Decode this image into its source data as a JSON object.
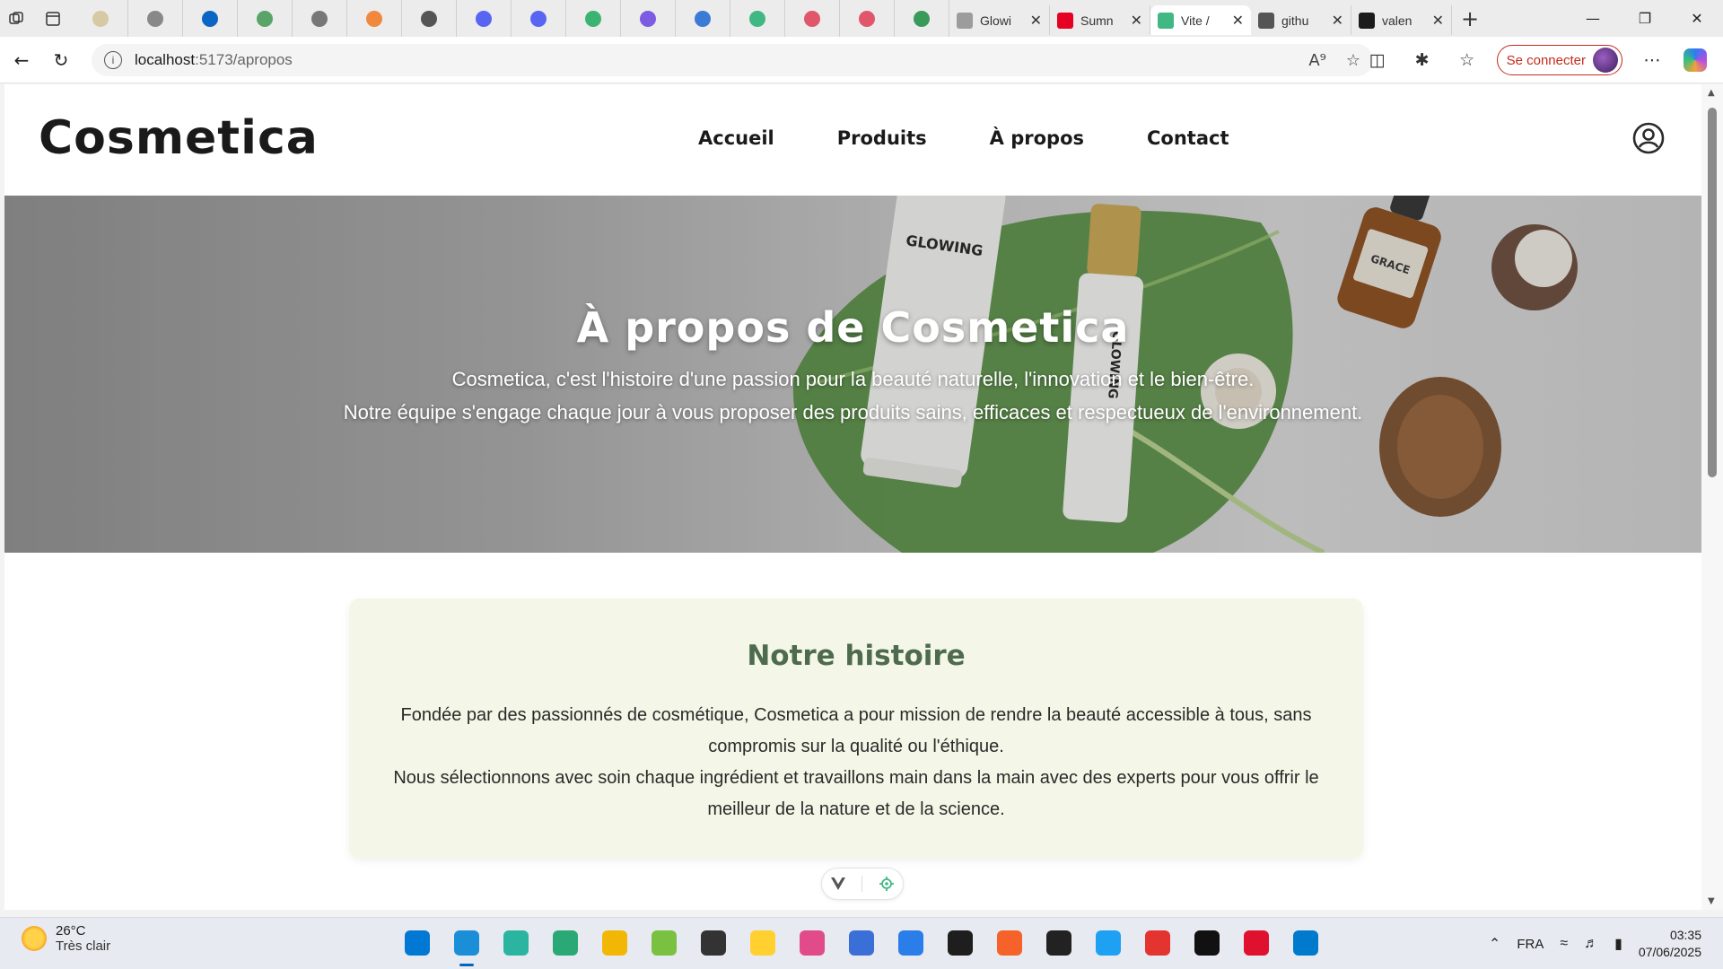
{
  "browser": {
    "pinned_tabs": [
      {
        "icon": "mug-icon",
        "color": "#d8c9a5"
      },
      {
        "icon": "circle-logo-icon",
        "color": "#888888"
      },
      {
        "icon": "linkedin-icon",
        "color": "#0a66c2"
      },
      {
        "icon": "w-logo-icon",
        "color": "#5aa469"
      },
      {
        "icon": "j-logo-icon",
        "color": "#777777"
      },
      {
        "icon": "diamond-icon",
        "color": "#f0883e"
      },
      {
        "icon": "openai-icon",
        "color": "#555555"
      },
      {
        "icon": "discord-icon",
        "color": "#5865f2"
      },
      {
        "icon": "globe-icon",
        "color": "#5865f2"
      },
      {
        "icon": "flower-icon",
        "color": "#3cb371"
      },
      {
        "icon": "canva-icon",
        "color": "#7b5ce3"
      },
      {
        "icon": "c-logo-icon",
        "color": "#3a7bd5"
      },
      {
        "icon": "vue-icon",
        "color": "#41b883"
      },
      {
        "icon": "youtube-icon",
        "color": "#e0566b"
      },
      {
        "icon": "youtube-icon",
        "color": "#e0566b"
      },
      {
        "icon": "leaf-icon",
        "color": "#3a9a5a"
      }
    ],
    "tabs": [
      {
        "title": "Glowi",
        "icon": "g-logo-icon",
        "color": "#9c9c9c",
        "active": false
      },
      {
        "title": "Sumn",
        "icon": "pinterest-icon",
        "color": "#e60023",
        "active": false
      },
      {
        "title": "Vite /",
        "icon": "vue-icon",
        "color": "#41b883",
        "active": true
      },
      {
        "title": "githu",
        "icon": "search-icon",
        "color": "#555555",
        "active": false
      },
      {
        "title": "valen",
        "icon": "github-icon",
        "color": "#1b1b1b",
        "active": false
      }
    ],
    "url_host": "localhost",
    "url_rest": ":5173/apropos",
    "connect_label": "Se connecter"
  },
  "site": {
    "logo": "Cosmetica",
    "nav": [
      "Accueil",
      "Produits",
      "À propos",
      "Contact"
    ],
    "hero": {
      "title": "À propos de Cosmetica",
      "line1": "Cosmetica, c'est l'histoire d'une passion pour la beauté naturelle, l'innovation et le bien-être.",
      "line2": "Notre équipe s'engage chaque jour à vous proposer des produits sains, efficaces et respectueux de l'environnement.",
      "product_labels": [
        "GLOWING",
        "GLOWING",
        "GRACE"
      ]
    },
    "story": {
      "title": "Notre histoire",
      "text1": "Fondée par des passionnés de cosmétique, Cosmetica a pour mission de rendre la beauté accessible à tous, sans compromis sur la qualité ou l'éthique.",
      "text2": "Nous sélectionnons avec soin chaque ingrédient et travaillons main dans la main avec des experts pour vous offrir le meilleur de la nature et de la science."
    }
  },
  "taskbar": {
    "weather_temp": "26°C",
    "weather_desc": "Très clair",
    "apps": [
      {
        "icon": "windows-start-icon",
        "color": "#0078d4"
      },
      {
        "icon": "edge-icon",
        "color": "#1a8fd8",
        "active": true
      },
      {
        "icon": "edge-dev-icon",
        "color": "#2bb5a0"
      },
      {
        "icon": "diamond-app-icon",
        "color": "#2aa876"
      },
      {
        "icon": "file-explorer-icon",
        "color": "#f2b705"
      },
      {
        "icon": "cloud-app-icon",
        "color": "#7ac142"
      },
      {
        "icon": "calendar-app-icon",
        "color": "#333333"
      },
      {
        "icon": "miro-icon",
        "color": "#ffd02f"
      },
      {
        "icon": "gem-app-icon",
        "color": "#e14b8a"
      },
      {
        "icon": "whiteboard-icon",
        "color": "#3a6fd8"
      },
      {
        "icon": "todo-icon",
        "color": "#2b7de9"
      },
      {
        "icon": "figma-icon",
        "color": "#1e1e1e"
      },
      {
        "icon": "pen-app-icon",
        "color": "#f5622a"
      },
      {
        "icon": "affinity-icon",
        "color": "#222222"
      },
      {
        "icon": "bird-app-icon",
        "color": "#1ea1f2"
      },
      {
        "icon": "wps-icon",
        "color": "#e3342f"
      },
      {
        "icon": "w-app-icon",
        "color": "#111111"
      },
      {
        "icon": "opera-icon",
        "color": "#e0102f"
      },
      {
        "icon": "vscode-icon",
        "color": "#007acc"
      }
    ],
    "lang": "FRA",
    "time": "03:35",
    "date": "07/06/2025"
  }
}
